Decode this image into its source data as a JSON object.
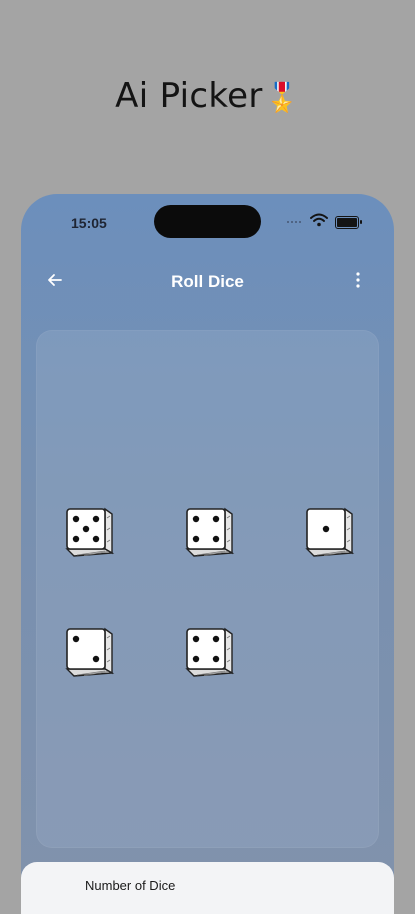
{
  "promo": {
    "title": "Ai Picker",
    "badge_icon": "military-medal-icon"
  },
  "status_bar": {
    "time": "15:05",
    "icons": [
      "cellular-signal-icon",
      "wifi-icon",
      "battery-icon"
    ]
  },
  "app_bar": {
    "title": "Roll Dice",
    "back_icon": "arrow-left-icon",
    "menu_icon": "more-vertical-icon"
  },
  "dice": [
    {
      "value": 5
    },
    {
      "value": 4
    },
    {
      "value": 1
    },
    {
      "value": 2
    },
    {
      "value": 4
    }
  ],
  "settings": {
    "number_of_dice_label": "Number of Dice"
  },
  "colors": {
    "background": "#a4a4a4",
    "app_gradient_top": "#6c8fbc",
    "app_gradient_bottom": "#8192ac",
    "sheet": "#f3f4f6"
  }
}
